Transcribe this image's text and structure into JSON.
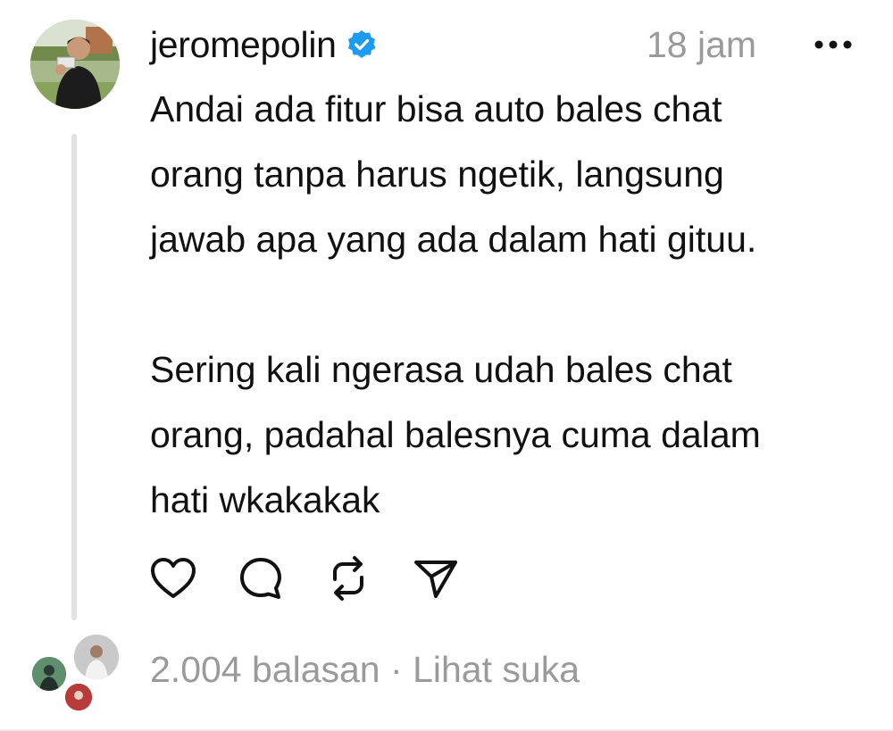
{
  "post": {
    "username": "jeromepolin",
    "verified": true,
    "timestamp": "18 jam",
    "more_icon": "more-horizontal-icon",
    "text": "Andai ada fitur bisa auto bales chat\norang tanpa harus ngetik, langsung\njawab apa yang ada dalam hati gituu.\n\nSering kali ngerasa udah bales chat\norang, padahal balesnya cuma dalam\nhati wkakakak",
    "actions": [
      "heart-icon",
      "comment-icon",
      "repost-icon",
      "share-icon"
    ]
  },
  "stats": {
    "replies": "2.004 balasan",
    "separator": "·",
    "likes_link": "Lihat suka"
  },
  "colors": {
    "verified_blue": "#1d9bf0",
    "muted_text": "#9a9a9a",
    "thread_line": "#e2e2e2"
  }
}
